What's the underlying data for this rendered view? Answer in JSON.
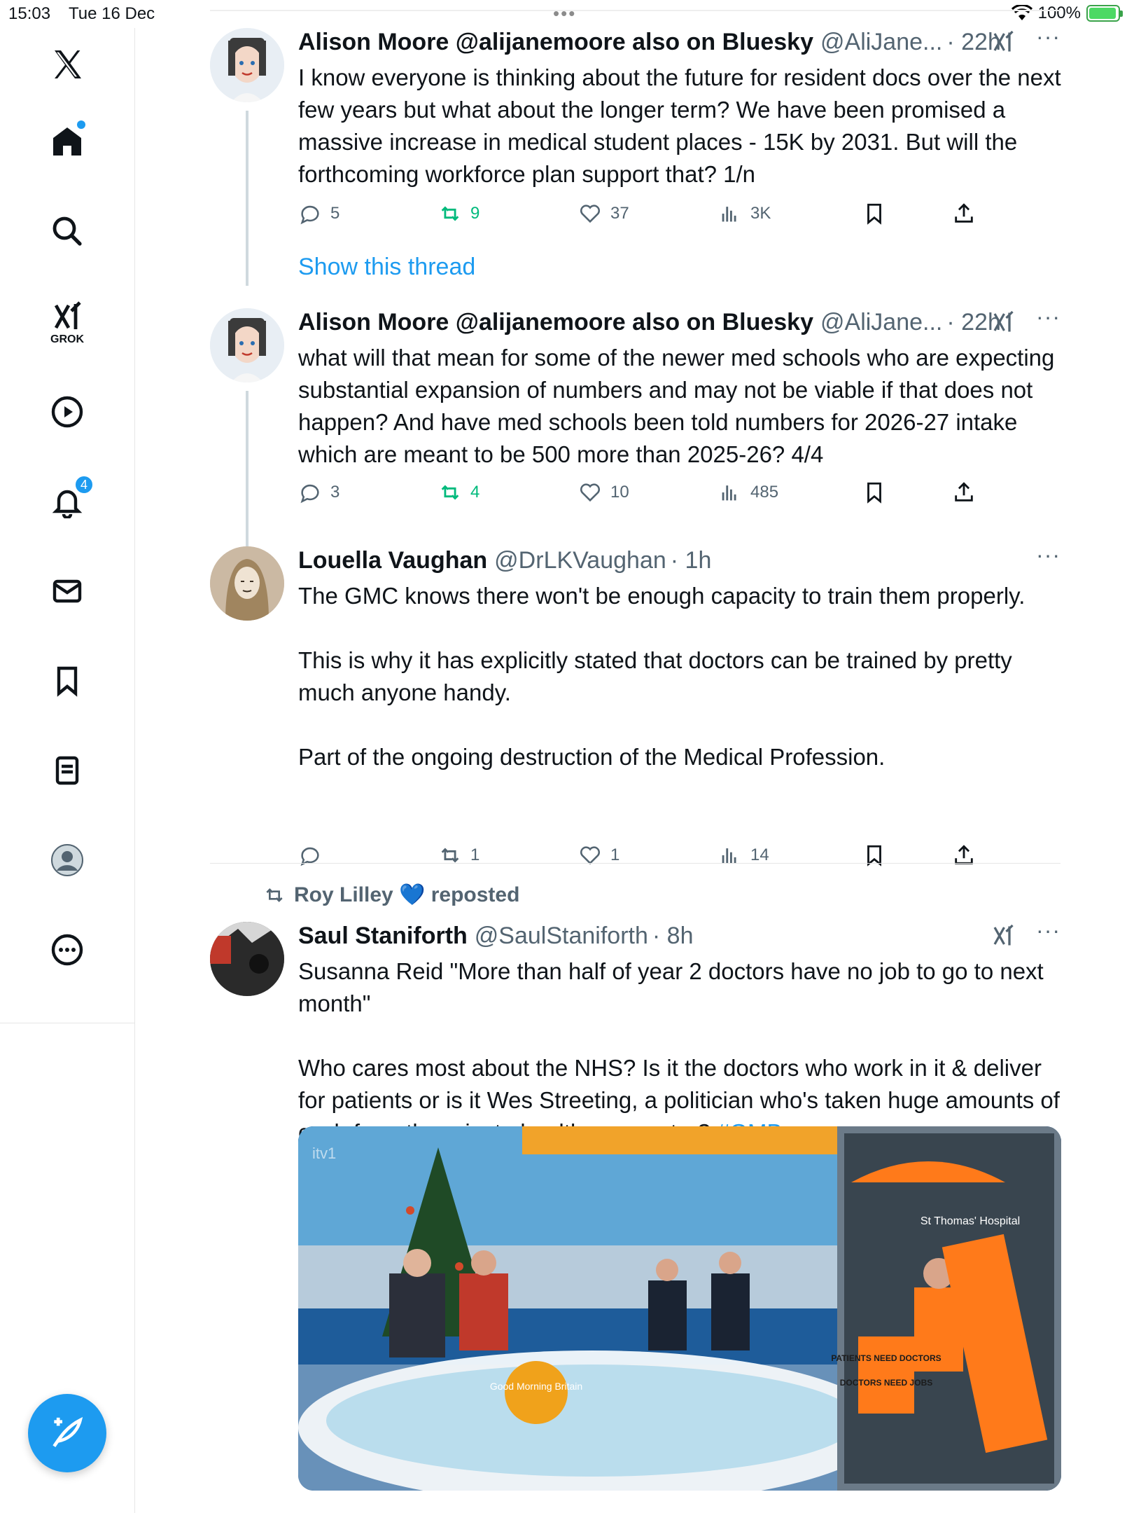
{
  "status_bar": {
    "time": "15:03",
    "date": "Tue 16 Dec",
    "battery": "100%"
  },
  "sidebar": {
    "items": [
      {
        "name": "x-logo",
        "label": ""
      },
      {
        "name": "home",
        "label": ""
      },
      {
        "name": "search",
        "label": ""
      },
      {
        "name": "grok",
        "label": "GROK"
      },
      {
        "name": "videos",
        "label": ""
      },
      {
        "name": "notifications",
        "label": "",
        "badge": "4"
      },
      {
        "name": "messages",
        "label": ""
      },
      {
        "name": "bookmarks",
        "label": ""
      },
      {
        "name": "lists",
        "label": ""
      },
      {
        "name": "profile",
        "label": ""
      },
      {
        "name": "more",
        "label": ""
      }
    ]
  },
  "posts": [
    {
      "name": "Alison Moore @alijanemoore also on Bluesky",
      "handle": "@AliJane...",
      "time": "· 22h",
      "text": "I know everyone is thinking about the future for resident docs over the next few years but what about the longer term? We have been promised a massive increase in medical student places - 15K by 2031. But will the forthcoming workforce plan support that? 1/n",
      "replies": "5",
      "reposts": "9",
      "likes": "37",
      "views": "3K",
      "show_thread": "Show this thread"
    },
    {
      "name": "Alison Moore @alijanemoore also on Bluesky",
      "handle": "@AliJane...",
      "time": "· 22h",
      "text": "what will that mean for some of the newer med schools who are expecting substantial expansion of numbers and may not be viable if that does not happen? And have med schools been told numbers for 2026-27 intake which are meant to be 500 more than 2025-26? 4/4",
      "replies": "3",
      "reposts": "4",
      "likes": "10",
      "views": "485"
    },
    {
      "name": "Louella Vaughan",
      "handle": "@DrLKVaughan",
      "time": "· 1h",
      "text": "The GMC knows there won't be enough capacity to train them properly.\n\nThis is why it has explicitly stated that doctors can be trained by pretty much anyone handy.\n\nPart of the ongoing destruction of the Medical Profession.",
      "replies": "",
      "reposts": "1",
      "likes": "1",
      "views": "14"
    },
    {
      "repost_label": "Roy Lilley 💙 reposted",
      "name": "Saul Staniforth",
      "handle": "@SaulStaniforth",
      "time": "· 8h",
      "text": "Susanna Reid \"More than half of year 2 doctors have no job to go to next month\"\n\nWho cares most about the NHS? Is it the doctors who work in it & deliver for patients or is it Wes Streeting, a politician who's taken huge amounts of cash from the private healthcare sector? ",
      "hashtag": "#GMB",
      "media": {
        "desc": "Good Morning Britain studio with presenters and guests; inset of protesters with placards",
        "placard_1": "PATIENTS NEED DOCTORS",
        "placard_2": "DOCTORS NEED JOBS",
        "logo": "Good Morning Britain",
        "hospital": "St Thomas' Hospital",
        "channel": "itv1"
      }
    }
  ],
  "colors": {
    "accent": "#1d9bf0",
    "repost": "#00ba7c",
    "muted": "#536471"
  }
}
